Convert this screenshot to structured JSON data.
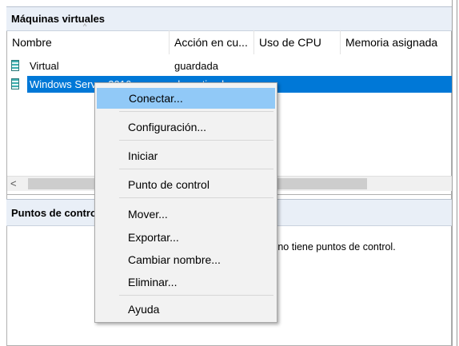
{
  "vm_panel": {
    "title": "Máquinas virtuales",
    "columns": [
      "Nombre",
      "Acción en cu...",
      "Uso de CPU",
      "Memoria asignada"
    ],
    "rows": [
      {
        "name": "Virtual",
        "state": "guardada"
      },
      {
        "name": "Windows Server 2016",
        "state": "desactivada"
      }
    ]
  },
  "checkpoints_panel": {
    "title": "Puntos de control",
    "empty_message": "La máquina virtual seleccionada no tiene puntos de control."
  },
  "context_menu": {
    "items": [
      "Conectar...",
      "Configuración...",
      "Iniciar",
      "Punto de control",
      "Mover...",
      "Exportar...",
      "Cambiar nombre...",
      "Eliminar...",
      "Ayuda"
    ],
    "highlighted": "Conectar..."
  },
  "colors": {
    "selection": "#0078d7",
    "menu_highlight": "#91c9f7",
    "header_bg": "#e9eff7"
  },
  "icons": {
    "vm": "virtual-machine-icon",
    "scroll_left": "chevron-left-icon",
    "sort": "sort-ascending-icon"
  }
}
